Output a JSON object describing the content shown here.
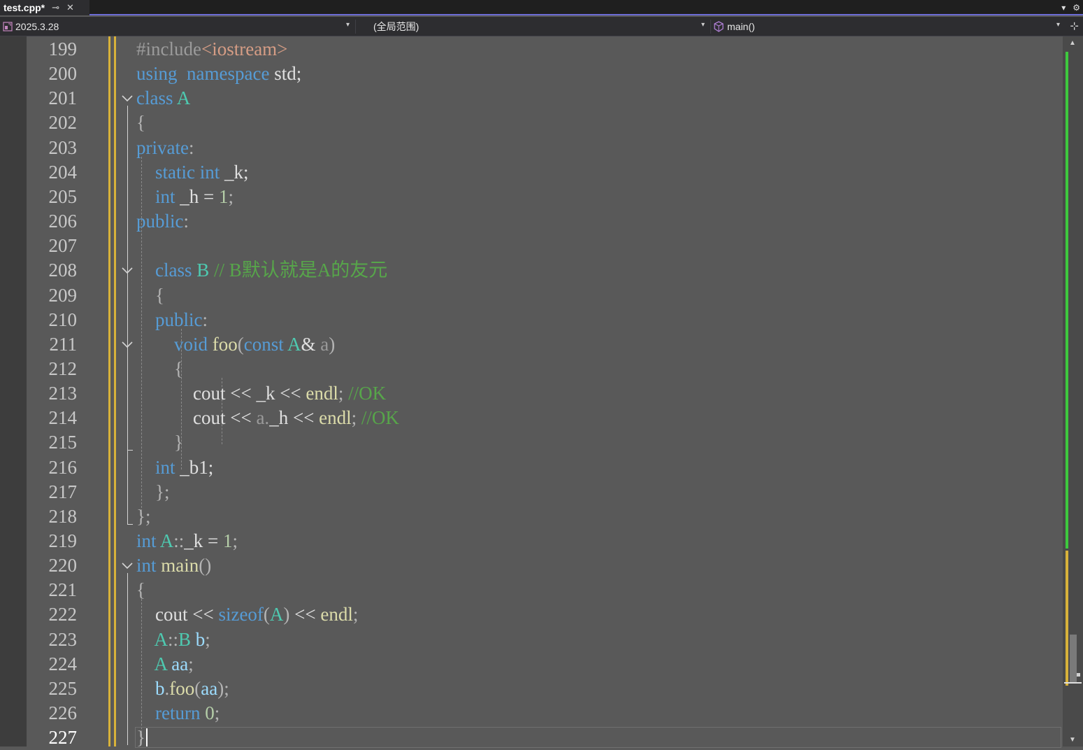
{
  "tab": {
    "title": "test.cpp*",
    "pin_glyph": "⊸",
    "close_glyph": "✕",
    "dropdown_glyph": "▾",
    "settings_glyph": "⚙"
  },
  "navbar": {
    "project": "2025.3.28",
    "scope": "(全局范围)",
    "member": "main()",
    "arrow_glyph": "▾",
    "split_glyph": "⊹"
  },
  "editor": {
    "lines": [
      {
        "num": "199"
      },
      {
        "num": "200"
      },
      {
        "num": "201"
      },
      {
        "num": "202"
      },
      {
        "num": "203"
      },
      {
        "num": "204"
      },
      {
        "num": "205"
      },
      {
        "num": "206"
      },
      {
        "num": "207"
      },
      {
        "num": "208"
      },
      {
        "num": "209"
      },
      {
        "num": "210"
      },
      {
        "num": "211"
      },
      {
        "num": "212"
      },
      {
        "num": "213"
      },
      {
        "num": "214"
      },
      {
        "num": "215"
      },
      {
        "num": "216"
      },
      {
        "num": "217"
      },
      {
        "num": "218"
      },
      {
        "num": "219"
      },
      {
        "num": "220"
      },
      {
        "num": "221"
      },
      {
        "num": "222"
      },
      {
        "num": "223"
      },
      {
        "num": "224"
      },
      {
        "num": "225"
      },
      {
        "num": "226"
      },
      {
        "num": "227"
      }
    ],
    "code": [
      [
        [
          "pp",
          "#include"
        ],
        [
          "st",
          "<iostream>"
        ]
      ],
      [
        [
          "kw",
          "using"
        ],
        [
          "",
          "  "
        ],
        [
          "kw",
          "namespace"
        ],
        [
          "",
          " std;"
        ]
      ],
      [
        [
          "kw",
          "class"
        ],
        [
          "",
          " "
        ],
        [
          "ty",
          "A"
        ]
      ],
      [
        [
          "pu",
          "{"
        ]
      ],
      [
        [
          "kw",
          "private"
        ],
        [
          "pu",
          ":"
        ]
      ],
      [
        [
          "",
          "    "
        ],
        [
          "kw",
          "static"
        ],
        [
          "",
          " "
        ],
        [
          "kw",
          "int"
        ],
        [
          "",
          " _k;"
        ]
      ],
      [
        [
          "",
          "    "
        ],
        [
          "kw",
          "int"
        ],
        [
          "",
          " _h = "
        ],
        [
          "nm",
          "1"
        ],
        [
          "pu",
          ";"
        ]
      ],
      [
        [
          "kw",
          "public"
        ],
        [
          "pu",
          ":"
        ]
      ],
      [
        [
          "",
          ""
        ]
      ],
      [
        [
          "",
          "    "
        ],
        [
          "kw",
          "class"
        ],
        [
          "",
          " "
        ],
        [
          "ty",
          "B"
        ],
        [
          "",
          " "
        ],
        [
          "cm",
          "// B默认就是A的友元"
        ]
      ],
      [
        [
          "",
          "    "
        ],
        [
          "pu",
          "{"
        ]
      ],
      [
        [
          "",
          "    "
        ],
        [
          "kw",
          "public"
        ],
        [
          "pu",
          ":"
        ]
      ],
      [
        [
          "",
          "        "
        ],
        [
          "kw",
          "void"
        ],
        [
          "",
          " "
        ],
        [
          "fn",
          "foo"
        ],
        [
          "pu",
          "("
        ],
        [
          "kw",
          "const"
        ],
        [
          "",
          " "
        ],
        [
          "ty",
          "A"
        ],
        [
          "",
          "& "
        ],
        [
          "pr",
          "a"
        ],
        [
          "pu",
          ")"
        ]
      ],
      [
        [
          "",
          "        "
        ],
        [
          "pu",
          "{"
        ]
      ],
      [
        [
          "",
          "            cout << _k << "
        ],
        [
          "fn",
          "endl"
        ],
        [
          "pu",
          ";"
        ],
        [
          "",
          " "
        ],
        [
          "cm",
          "//OK"
        ]
      ],
      [
        [
          "",
          "            cout << "
        ],
        [
          "pr",
          "a."
        ],
        [
          "",
          "_h << "
        ],
        [
          "fn",
          "endl"
        ],
        [
          "pu",
          ";"
        ],
        [
          "",
          " "
        ],
        [
          "cm",
          "//OK"
        ]
      ],
      [
        [
          "",
          "        "
        ],
        [
          "pu",
          "}"
        ]
      ],
      [
        [
          "",
          "    "
        ],
        [
          "kw",
          "int"
        ],
        [
          "",
          " _b1;"
        ]
      ],
      [
        [
          "",
          "    "
        ],
        [
          "pu",
          "};"
        ]
      ],
      [
        [
          "pu",
          "};"
        ]
      ],
      [
        [
          "kw",
          "int"
        ],
        [
          "",
          " "
        ],
        [
          "ty",
          "A"
        ],
        [
          "pu",
          "::"
        ],
        [
          "",
          "_k = "
        ],
        [
          "nm",
          "1"
        ],
        [
          "pu",
          ";"
        ]
      ],
      [
        [
          "kw",
          "int"
        ],
        [
          "",
          " "
        ],
        [
          "fn",
          "main"
        ],
        [
          "pu",
          "()"
        ]
      ],
      [
        [
          "pu",
          "{"
        ]
      ],
      [
        [
          "",
          "    cout << "
        ],
        [
          "kw",
          "sizeof"
        ],
        [
          "pu",
          "("
        ],
        [
          "ty",
          "A"
        ],
        [
          "pu",
          ")"
        ],
        [
          "",
          " << "
        ],
        [
          "fn",
          "endl"
        ],
        [
          "pu",
          ";"
        ]
      ],
      [
        [
          "",
          "    "
        ],
        [
          "ty",
          "A"
        ],
        [
          "pu",
          "::"
        ],
        [
          "ty",
          "B"
        ],
        [
          "",
          " "
        ],
        [
          "vr",
          "b"
        ],
        [
          "pu",
          ";"
        ]
      ],
      [
        [
          "",
          "    "
        ],
        [
          "ty",
          "A"
        ],
        [
          "",
          " "
        ],
        [
          "vr",
          "aa"
        ],
        [
          "pu",
          ";"
        ]
      ],
      [
        [
          "",
          "    "
        ],
        [
          "vr",
          "b"
        ],
        [
          "pu",
          "."
        ],
        [
          "fn",
          "foo"
        ],
        [
          "pu",
          "("
        ],
        [
          "vr",
          "aa"
        ],
        [
          "pu",
          ");"
        ]
      ],
      [
        [
          "",
          "    "
        ],
        [
          "kw",
          "return"
        ],
        [
          "",
          " "
        ],
        [
          "nm",
          "0"
        ],
        [
          "pu",
          ";"
        ]
      ],
      [
        [
          "pu",
          "}"
        ]
      ]
    ]
  },
  "scrollbar": {
    "up_glyph": "▲",
    "down_glyph": "▼"
  },
  "colors": {
    "keyword": "#569cd6",
    "type": "#4ec9b0",
    "function": "#dcdcaa",
    "comment": "#57a64a",
    "number": "#b5cea8",
    "change_marker": "#d8b23a",
    "saved_marker": "#3ec93e",
    "editor_background": "#595959"
  }
}
